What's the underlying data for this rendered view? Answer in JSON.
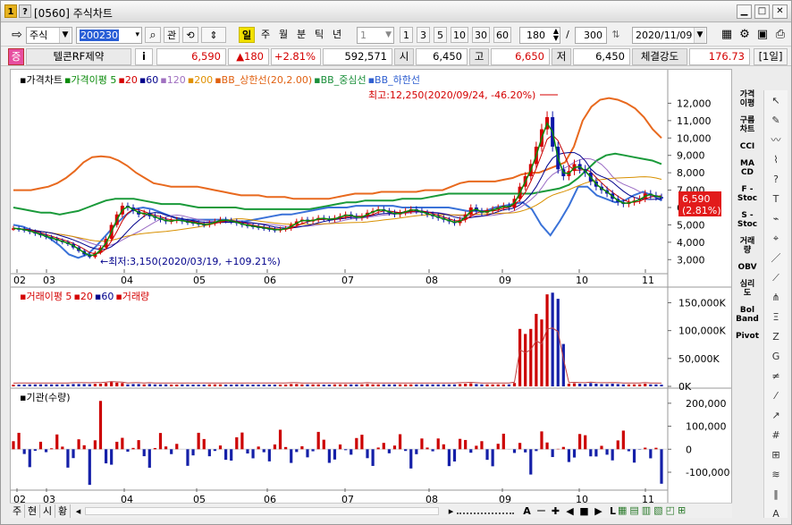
{
  "window": {
    "num_badge": "1",
    "help_badge": "?",
    "title": "[0560] 주식차트",
    "min": "▁",
    "max": "□",
    "close": "✕"
  },
  "toolbar": {
    "market": "주식",
    "code": "200230",
    "search": "⌕",
    "gwan": "관",
    "period_active": "일",
    "periods": [
      "주",
      "월",
      "분",
      "틱",
      "년"
    ],
    "interval": "1",
    "quick_counts": [
      "1",
      "3",
      "5",
      "10",
      "30",
      "60"
    ],
    "count": "180",
    "slash": "/",
    "total": "300",
    "date": "2020/11/09"
  },
  "quote": {
    "code_badge": "증",
    "name": "텔콘RF제약",
    "info": "i",
    "price": "6,590",
    "change": "▲180",
    "pct": "+2.81%",
    "volume": "592,571",
    "open_label": "시",
    "open": "6,450",
    "high_label": "고",
    "high": "6,650",
    "low_label": "저",
    "low": "6,450",
    "strength_label": "체결강도",
    "strength": "176.73",
    "unit": "[1일]"
  },
  "price_legend": [
    {
      "t": "▪가격차트",
      "c": "#000"
    },
    {
      "t": "▪가격이평 5",
      "c": "#0a8a0a"
    },
    {
      "t": "▪20",
      "c": "#d40000"
    },
    {
      "t": "▪60",
      "c": "#00008b"
    },
    {
      "t": "▪120",
      "c": "#a070c0"
    },
    {
      "t": "▪200",
      "c": "#e09000"
    },
    {
      "t": "▪BB_상한선(20,2.00)",
      "c": "#e06010"
    },
    {
      "t": "▪BB_중심선",
      "c": "#1a8f3a"
    },
    {
      "t": "▪BB_하한선",
      "c": "#3060d0"
    }
  ],
  "vol_legend": [
    {
      "t": "▪거래이평 5",
      "c": "#d40000"
    },
    {
      "t": "▪20",
      "c": "#d40000"
    },
    {
      "t": "▪60",
      "c": "#00008b"
    },
    {
      "t": "▪거래량",
      "c": "#d40000"
    }
  ],
  "inst_legend": [
    {
      "t": "▪기관(수량)",
      "c": "#000"
    }
  ],
  "annotations": {
    "high": "최고:12,250(2020/09/24, -46.20%)",
    "low": "최저:3,150(2020/03/19, +109.21%)",
    "price_tag": "6,590",
    "pct_tag": "(2.81%)"
  },
  "chart_data": [
    {
      "type": "line",
      "title": "가격차트",
      "ylim": [
        2500,
        13000
      ],
      "yticks": [
        "12,000",
        "11,000",
        "10,000",
        "9,000",
        "8,000",
        "7,000",
        "6,000",
        "5,000",
        "4,000",
        "3,000"
      ],
      "months": [
        "02",
        "03",
        "04",
        "05",
        "06",
        "07",
        "08",
        "09",
        "10",
        "11"
      ],
      "close": [
        4800,
        4750,
        4700,
        4600,
        4500,
        4400,
        4300,
        4200,
        4100,
        4000,
        3900,
        3700,
        3500,
        3300,
        3150,
        3400,
        3700,
        4200,
        5000,
        5600,
        6100,
        6000,
        5800,
        5600,
        5700,
        5500,
        5400,
        5300,
        5200,
        5250,
        5300,
        5200,
        5150,
        5100,
        5050,
        5000,
        5100,
        5200,
        5300,
        5250,
        5200,
        5100,
        5000,
        4950,
        4900,
        4850,
        4800,
        4750,
        4700,
        4750,
        4800,
        5000,
        5200,
        5300,
        5200,
        5300,
        5400,
        5350,
        5300,
        5400,
        5500,
        5600,
        5500,
        5400,
        5500,
        5700,
        5800,
        5900,
        5800,
        5700,
        5600,
        5700,
        5800,
        5900,
        5800,
        5700,
        5600,
        5500,
        5400,
        5300,
        5200,
        5100,
        5300,
        5600,
        6000,
        5800,
        5700,
        5800,
        5900,
        6000,
        6100,
        6000,
        6500,
        7200,
        7800,
        8500,
        9500,
        10500,
        11200,
        9500,
        8200,
        7800,
        8100,
        8500,
        8200,
        8000,
        7500,
        7200,
        7000,
        6800,
        6500,
        6300,
        6200,
        6300,
        6400,
        6500,
        6800,
        6700,
        6600,
        6590
      ],
      "bb_upper": [
        7000,
        7000,
        7000,
        7100,
        7200,
        7400,
        7700,
        8100,
        8600,
        8900,
        8950,
        8900,
        8700,
        8400,
        8000,
        7700,
        7400,
        7300,
        7200,
        7200,
        7200,
        7200,
        7100,
        7000,
        6900,
        6800,
        6700,
        6700,
        6700,
        6600,
        6600,
        6600,
        6500,
        6500,
        6500,
        6500,
        6500,
        6600,
        6700,
        6800,
        6800,
        6800,
        6900,
        6900,
        6900,
        6900,
        6900,
        7000,
        7000,
        7000,
        7200,
        7400,
        7500,
        7500,
        7500,
        7500,
        7600,
        7700,
        7900,
        8000,
        8000,
        8200,
        8400,
        8600,
        9500,
        11000,
        11800,
        12200,
        12300,
        12200,
        12000,
        11700,
        11200,
        10500,
        10000
      ],
      "bb_mid": [
        6000,
        5900,
        5800,
        5700,
        5700,
        5600,
        5700,
        5800,
        6000,
        6200,
        6400,
        6500,
        6500,
        6500,
        6400,
        6300,
        6200,
        6200,
        6200,
        6100,
        6000,
        6000,
        6000,
        6000,
        6000,
        5900,
        5900,
        5900,
        5900,
        5900,
        5900,
        5900,
        5900,
        6000,
        6100,
        6200,
        6300,
        6300,
        6400,
        6400,
        6400,
        6400,
        6500,
        6500,
        6500,
        6600,
        6700,
        6800,
        6800,
        6800,
        6800,
        6800,
        6800,
        6800,
        6800,
        6800,
        6800,
        6900,
        7000,
        7100,
        7300,
        7700,
        8200,
        8700,
        9000,
        9100,
        9000,
        8900,
        8800,
        8700,
        8500
      ],
      "bb_lower": [
        5000,
        4900,
        4700,
        4500,
        4200,
        3800,
        3300,
        3100,
        3300,
        3800,
        4400,
        5000,
        5500,
        5900,
        6000,
        5900,
        5700,
        5500,
        5300,
        5300,
        5300,
        5300,
        5300,
        5300,
        5200,
        5200,
        5300,
        5400,
        5500,
        5600,
        5600,
        5700,
        5800,
        5900,
        6000,
        6000,
        6000,
        6100,
        6100,
        6100,
        6100,
        6100,
        6000,
        6000,
        6000,
        6000,
        6000,
        6000,
        5900,
        5800,
        5800,
        5800,
        6000,
        6100,
        6200,
        6300,
        5900,
        5000,
        4400,
        5200,
        6100,
        7200,
        7200,
        6700,
        6500,
        6300,
        6400,
        6700,
        6900,
        6700,
        6400
      ]
    },
    {
      "type": "bar",
      "title": "거래량",
      "ylim": [
        0,
        170000
      ],
      "yticks": [
        "150,000K",
        "100,000K",
        "50,000K",
        "0K"
      ]
    },
    {
      "type": "bar",
      "title": "기관(수량)",
      "ylim": [
        -170000,
        250000
      ],
      "yticks": [
        "200,000",
        "100,000",
        "0",
        "-100,000"
      ]
    }
  ],
  "side_indicators": [
    "가격\n이평",
    "구름\n차트",
    "CCI",
    "MA\nCD",
    "F -\nStoc",
    "S -\nStoc",
    "거래\n량",
    "OBV",
    "심리\n도",
    "Bol\nBand",
    "Pivot"
  ],
  "tool_icons": [
    "↖",
    "✎",
    "〰",
    "⌇",
    "?",
    "T",
    "⌁",
    "⌖",
    "／",
    "⟋",
    "⋔",
    "Ξ",
    "Z",
    "G",
    "≠",
    "⁄",
    "↗",
    "#",
    "⊞",
    "≋",
    "‖",
    "A"
  ],
  "bottom": {
    "tabs": [
      "주",
      "현",
      "시",
      "황"
    ],
    "arrow": "◂",
    "arrow_r": "▸",
    "letters": [
      "A",
      "ー",
      "✚",
      "◀",
      "■",
      "▶",
      "L"
    ]
  }
}
